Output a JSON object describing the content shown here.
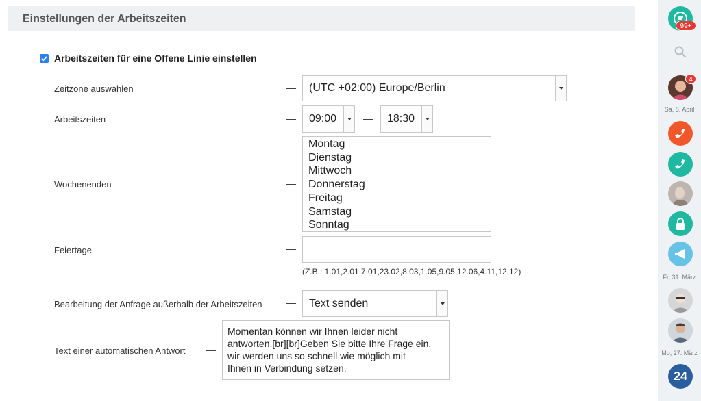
{
  "section": {
    "title": "Einstellungen der Arbeitszeiten"
  },
  "working_hours_toggle": {
    "label": "Arbeitszeiten für eine Offene Linie einstellen",
    "checked": true
  },
  "timezone": {
    "label": "Zeitzone auswählen",
    "value": "(UTC +02:00) Europe/Berlin"
  },
  "hours": {
    "label": "Arbeitszeiten",
    "from": "09:00",
    "to": "18:30"
  },
  "weekends": {
    "label": "Wochenenden",
    "options": [
      "Montag",
      "Dienstag",
      "Mittwoch",
      "Donnerstag",
      "Freitag",
      "Samstag",
      "Sonntag"
    ]
  },
  "holidays": {
    "label": "Feiertage",
    "value": "",
    "hint": "(Z.B.: 1.01,2.01,7.01,23.02,8.03,1.05,9.05,12.06,4.11,12.12)"
  },
  "outside_hours": {
    "label": "Bearbeitung der Anfrage außerhalb der Arbeitszeiten",
    "value": "Text senden"
  },
  "auto_reply": {
    "label": "Text einer automatischen Antwort",
    "lines": [
      "Momentan können wir Ihnen leider nicht",
      "antworten.[br][br]Geben Sie bitte Ihre Frage ein,",
      "wir werden uns so schnell wie möglich mit",
      "Ihnen in Verbindung setzen."
    ]
  },
  "sidebar": {
    "chat_badge": "99+",
    "avatar_badge": "4",
    "dates": [
      "Sa, 8. April",
      "Fr, 31. März",
      "Mo, 27. März"
    ],
    "logo_text": "24",
    "colors": {
      "teal": "#1fb8a0",
      "orange": "#f0582b",
      "light_blue": "#67c3e6",
      "dark_blue": "#2a5d9e"
    }
  }
}
